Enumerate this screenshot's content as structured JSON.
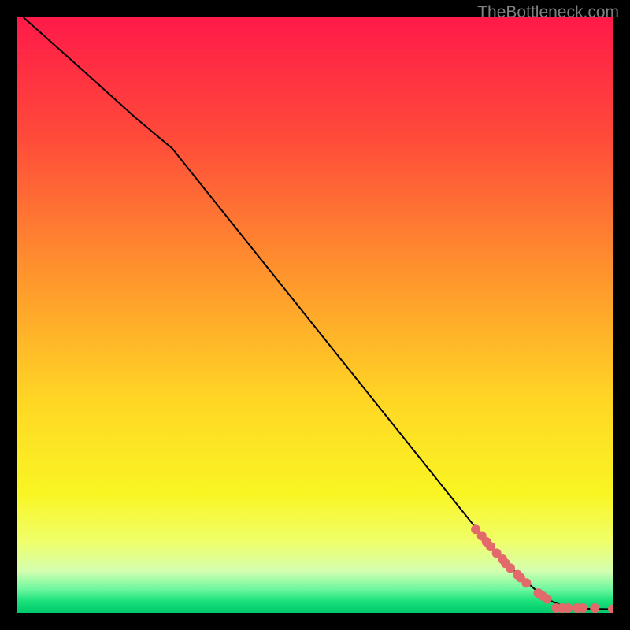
{
  "watermark": "TheBottleneck.com",
  "chart_data": {
    "type": "line",
    "title": "",
    "xlabel": "",
    "ylabel": "",
    "xlim": [
      0,
      100
    ],
    "ylim": [
      0,
      100
    ],
    "grid": false,
    "background_gradient": {
      "stops": [
        {
          "offset": 0.0,
          "color": "#ff1a49"
        },
        {
          "offset": 0.2,
          "color": "#ff4a3a"
        },
        {
          "offset": 0.45,
          "color": "#ff9a2c"
        },
        {
          "offset": 0.65,
          "color": "#ffd824"
        },
        {
          "offset": 0.8,
          "color": "#f9f523"
        },
        {
          "offset": 0.88,
          "color": "#f0ff6a"
        },
        {
          "offset": 0.93,
          "color": "#d4ffb0"
        },
        {
          "offset": 0.96,
          "color": "#70f7a0"
        },
        {
          "offset": 0.98,
          "color": "#1de27d"
        },
        {
          "offset": 1.0,
          "color": "#00c86a"
        }
      ]
    },
    "series": [
      {
        "name": "curve",
        "color": "#000000",
        "stroke_width": 2,
        "x": [
          1,
          10,
          20,
          26,
          30,
          40,
          50,
          60,
          70,
          78,
          84,
          88,
          90,
          92,
          94,
          100
        ],
        "y": [
          100,
          92,
          83,
          78,
          73,
          60.5,
          48,
          35.5,
          23,
          13,
          6.5,
          3.0,
          1.8,
          1.0,
          0.7,
          0.6
        ]
      }
    ],
    "scatter": {
      "name": "points",
      "color": "#e26a6a",
      "radius": 6,
      "x": [
        77.0,
        78.0,
        78.8,
        79.5,
        80.5,
        81.5,
        82.0,
        82.8,
        84.0,
        84.5,
        85.5,
        87.5,
        88.2,
        89.0,
        90.5,
        91.5,
        92.5,
        94.0,
        95.0,
        97.0,
        100.0
      ],
      "y": [
        14.0,
        12.9,
        11.9,
        11.1,
        10.0,
        9.0,
        8.3,
        7.5,
        6.4,
        5.9,
        5.0,
        3.3,
        2.8,
        2.3,
        0.8,
        0.8,
        0.8,
        0.8,
        0.8,
        0.8,
        0.6
      ]
    }
  }
}
